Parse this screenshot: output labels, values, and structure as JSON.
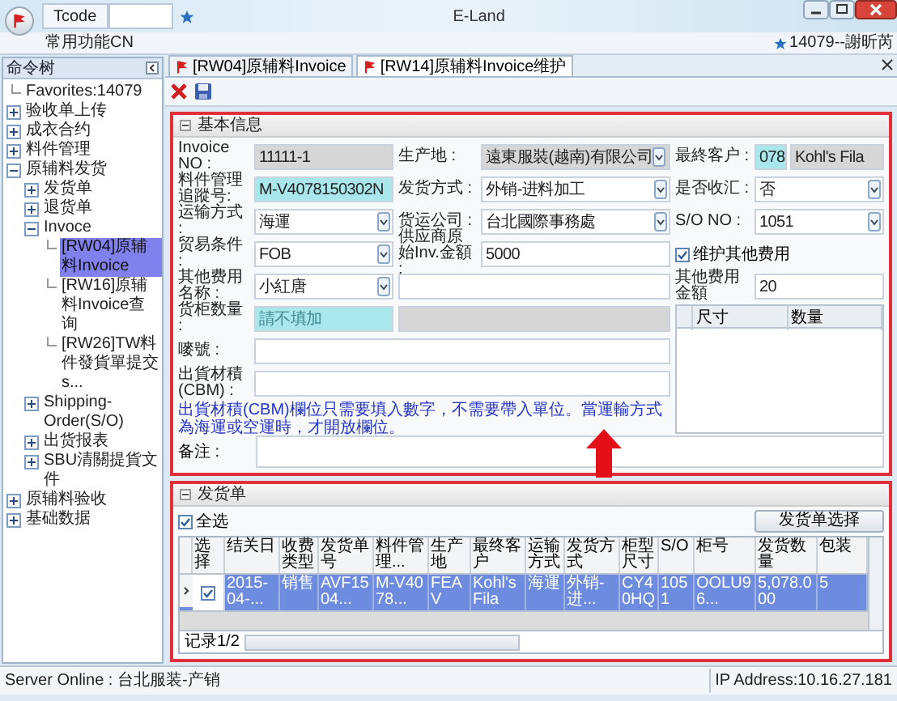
{
  "window": {
    "app_tab": "Tcode",
    "title": "E-Land"
  },
  "ribbon": {
    "menu": "常用功能CN",
    "user": "14079--謝昕芮"
  },
  "sidebar": {
    "title": "命令树",
    "tree": [
      {
        "label": "Favorites:14079",
        "selected": false
      },
      {
        "label": "验收单上传",
        "selected": false,
        "expanded": false
      },
      {
        "label": "成衣合约",
        "selected": false,
        "expanded": false
      },
      {
        "label": "料件管理",
        "selected": false,
        "expanded": false
      },
      {
        "label": "原辅料发货",
        "selected": false,
        "expanded": true,
        "children": [
          {
            "label": "发货单",
            "selected": false,
            "expanded": false
          },
          {
            "label": "退货单",
            "selected": false,
            "expanded": false
          },
          {
            "label": "Invoce",
            "selected": false,
            "expanded": true,
            "children": [
              {
                "label": "[RW04]原辅料Invoice",
                "selected": true
              },
              {
                "label": "[RW16]原辅料Invoice查询",
                "selected": false
              },
              {
                "label": "[RW26]TW料件發貨單提交 s...",
                "selected": false
              }
            ]
          },
          {
            "label": "Shipping-Order(S/O)",
            "selected": false,
            "expanded": false
          },
          {
            "label": "出货报表",
            "selected": false,
            "expanded": false
          },
          {
            "label": "SBU清關提貨文件",
            "selected": false,
            "expanded": false
          }
        ]
      },
      {
        "label": "原辅料验收",
        "selected": false,
        "expanded": false
      },
      {
        "label": "基础数据",
        "selected": false,
        "expanded": false
      }
    ]
  },
  "tabs": [
    {
      "label": "[RW04]原辅料Invoice",
      "selected": false
    },
    {
      "label": "[RW14]原辅料Invoice维护",
      "selected": true
    }
  ],
  "basic_info": {
    "title": "基本信息",
    "expanded": true,
    "fields": [
      {
        "label": "Invoice NO :",
        "kind": "readonly",
        "value": "11111-1"
      },
      {
        "label": "生产地 :",
        "kind": "readonly_select",
        "value": "遠東服裝(越南)有限公司"
      },
      {
        "label": "最終客户 :",
        "kind": "code_name",
        "code": "078",
        "value": "Kohl's Fila"
      },
      {
        "label": "料件管理追蹤号:",
        "kind": "highlight",
        "value": "M-V4078150302N"
      },
      {
        "label": "发货方式 :",
        "kind": "select",
        "value": "外销-进料加工"
      },
      {
        "label": "是否收汇 :",
        "kind": "select",
        "value": "否"
      },
      {
        "label": "运输方式 :",
        "kind": "select",
        "value": "海運"
      },
      {
        "label": "货运公司 :",
        "kind": "select",
        "value": "台北國際事務處"
      },
      {
        "label": "S/O NO :",
        "kind": "select",
        "value": "1051"
      },
      {
        "label": "贸易条件 :",
        "kind": "select",
        "value": "FOB"
      },
      {
        "label": "供应商原始Inv.金額 :",
        "kind": "text",
        "value": "5000"
      },
      {
        "label": "维护其他费用",
        "kind": "checkbox",
        "checked": true
      },
      {
        "label": "其他费用名称 :",
        "kind": "select",
        "value": "小紅唐"
      },
      {
        "kind": "text"
      },
      {
        "label": "其他费用金額",
        "kind": "text",
        "value": "20"
      }
    ],
    "lower_fields": [
      {
        "label": "货柜数量 :",
        "kind": "highlight",
        "placeholder": "請不填加"
      },
      {
        "kind": "readonly"
      },
      {
        "label": "嘜號 :",
        "kind": "wide"
      },
      {
        "label": "出貨材積(CBM) :",
        "kind": "wide"
      }
    ],
    "note": "出貨材積(CBM)欄位只需要填入數字，不需要帶入單位。當運輸方式為海運或空運時，才開放欄位。",
    "size_table": {
      "columns": [
        "尺寸",
        "数量"
      ]
    },
    "remarks": {
      "label": "备注 :"
    }
  },
  "shipping": {
    "title": "发货单",
    "expanded": true,
    "select_all": {
      "label": "全选",
      "checked": true
    },
    "button": "发货单选择",
    "checkbox_column": "选择",
    "columns": [
      "结关日",
      "收费类型",
      "发货单号",
      "料件管理...",
      "生产地",
      "最终客户",
      "运输方式",
      "发货方式",
      "柜型尺寸",
      "S/O",
      "柜号",
      "发货数量",
      "包装"
    ],
    "rows": [
      {
        "selected": true,
        "checked": true,
        "cells": [
          "2015-04-...",
          "销售",
          "AVF1504...",
          "M-V4078...",
          "FEAV",
          "Kohl's Fila",
          "海運",
          "外销-进...",
          "CY40HQ",
          "1051",
          "OOLU96...",
          "5,078.000",
          "5"
        ]
      }
    ],
    "record": "记录1/2"
  },
  "status_bar": {
    "left": "Server Online : 台北服装-产销",
    "right": "IP Address:10.16.27.181"
  }
}
